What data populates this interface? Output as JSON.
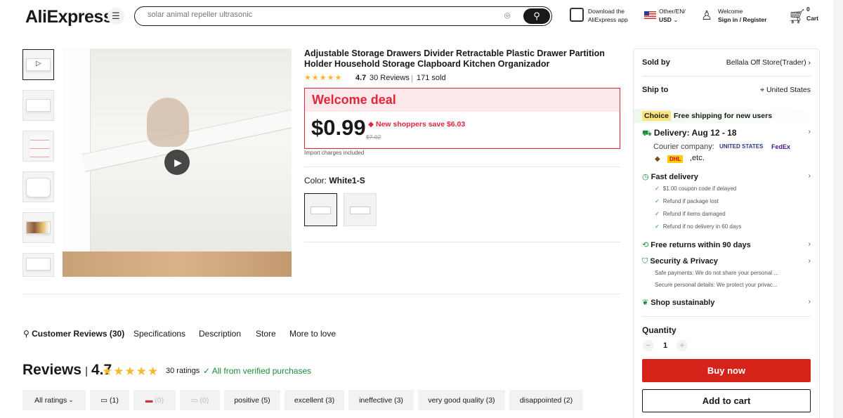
{
  "header": {
    "logo": "AliExpress",
    "search_placeholder": "solar animal repeller ultrasonic",
    "app_line1": "Download the",
    "app_line2": "AliExpress app",
    "lang_line1": "Other/EN/",
    "lang_line2": "USD",
    "welcome_line1": "Welcome",
    "welcome_line2": "Sign in / Register",
    "cart_count": "0",
    "cart_label": "Cart"
  },
  "product": {
    "title": "Adjustable Storage Drawers Divider Retractable Plastic Drawer Partition Holder Household Storage Clapboard Kitchen Organizador",
    "stars": "★★★★★",
    "rating": "4.7",
    "reviews": "30 Reviews",
    "sold": "171 sold",
    "deal_title": "Welcome deal",
    "price": "$0.99",
    "save_text": "New shoppers save $6.03",
    "original_price": "$7.02",
    "import_note": "Import charges included",
    "color_label": "Color:",
    "color_value": "White1-S"
  },
  "panel": {
    "sold_by_label": "Sold by",
    "seller": "Bellala Off Store(Trader)",
    "ship_to_label": "Ship to",
    "ship_to": "United States",
    "choice_tag": "Choice",
    "choice_text": "Free shipping for new users",
    "delivery": "Delivery: Aug 12 - 18",
    "courier_label": "Courier company:",
    "courier_etc": ",etc.",
    "fast_delivery": "Fast delivery",
    "guarantees": [
      "$1.00 coupon code if delayed",
      "Refund if package lost",
      "Refund if items damaged",
      "Refund if no delivery in 60 days"
    ],
    "free_returns": "Free returns within 90 days",
    "security": "Security & Privacy",
    "security_line1": "Safe payments: We do not share your personal ...",
    "security_line2": "Secure personal details: We protect your privac...",
    "sustainably": "Shop sustainably",
    "quantity_label": "Quantity",
    "quantity": "1",
    "buy_now": "Buy now",
    "add_to_cart": "Add to cart"
  },
  "tabs": {
    "reviews": "Customer Reviews (30)",
    "specs": "Specifications",
    "description": "Description",
    "store": "Store",
    "more": "More to love"
  },
  "reviews_section": {
    "heading": "Reviews",
    "rating": "4.7",
    "stars": "★★★★★",
    "count": "30 ratings",
    "verified": "All from verified purchases",
    "filters": [
      "All ratings",
      "(1)",
      "(0)",
      "(0)",
      "positive (5)",
      "excellent (3)",
      "ineffective (3)",
      "very good quality (3)",
      "disappointed (2)"
    ]
  }
}
